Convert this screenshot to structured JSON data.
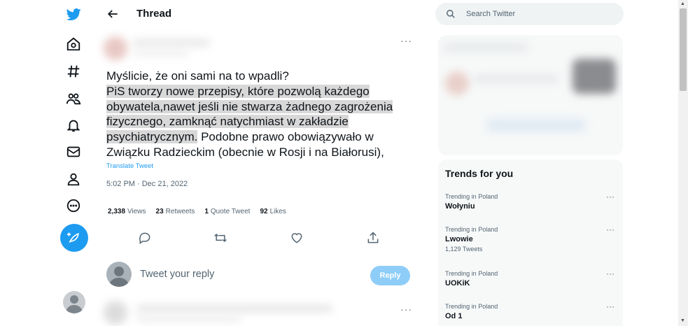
{
  "header": {
    "title": "Thread"
  },
  "tweet": {
    "text_plain_1": "Myślicie, że oni sami na to wpadli?",
    "text_highlight": "PiS tworzy nowe przepisy, które pozwolą każdego obywatela,nawet jeśli nie stwarza żadnego zagrożenia fizycznego, zamknąć natychmiast w zakładzie psychiatrycznym.",
    "text_plain_2": " Podobne prawo obowiązywało w Związku Radzieckim (obecnie w Rosji i na Białorusi),",
    "translate_label": "Translate Tweet",
    "timestamp": "5:02 PM · Dec 21, 2022",
    "stats": {
      "views_count": "2,338",
      "views_label": "Views",
      "retweets_count": "23",
      "retweets_label": "Retweets",
      "quotes_count": "1",
      "quotes_label": "Quote Tweet",
      "likes_count": "92",
      "likes_label": "Likes"
    }
  },
  "reply": {
    "placeholder": "Tweet your reply",
    "button_label": "Reply"
  },
  "search": {
    "placeholder": "Search Twitter"
  },
  "trends": {
    "title": "Trends for you",
    "items": [
      {
        "context": "Trending in Poland",
        "name": "Wołyniu",
        "count": ""
      },
      {
        "context": "Trending in Poland",
        "name": "Lwowie",
        "count": "1,129 Tweets"
      },
      {
        "context": "Trending in Poland",
        "name": "UOKiK",
        "count": ""
      },
      {
        "context": "Trending in Poland",
        "name": "Od 1",
        "count": ""
      }
    ]
  },
  "more_glyph": "···",
  "colors": {
    "accent": "#1d9bf0",
    "reply_button": "#8ecdf8",
    "highlight": "#d8d8d8"
  },
  "icons": [
    "twitter-logo-icon",
    "home-icon",
    "explore-hash-icon",
    "communities-icon",
    "notifications-bell-icon",
    "messages-envelope-icon",
    "profile-icon",
    "more-circle-icon",
    "compose-icon",
    "back-arrow-icon",
    "reply-icon",
    "retweet-icon",
    "like-heart-icon",
    "share-icon",
    "search-icon"
  ]
}
